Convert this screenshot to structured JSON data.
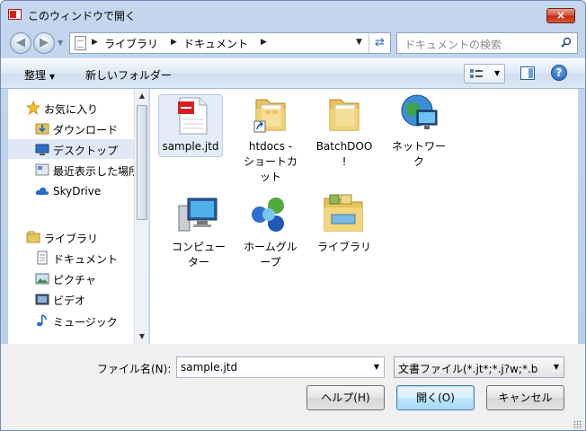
{
  "window": {
    "title": "このウィンドウで開く",
    "close_label": "×"
  },
  "address": {
    "crumbs": [
      "ライブラリ",
      "ドキュメント"
    ]
  },
  "search": {
    "placeholder": "ドキュメントの検索"
  },
  "toolbar": {
    "organize_label": "整理",
    "new_folder_label": "新しいフォルダー",
    "help_label": "?"
  },
  "nav": {
    "favorites_header": "お気に入り",
    "favorites": [
      "ダウンロード",
      "デスクトップ",
      "最近表示した場所",
      "SkyDrive"
    ],
    "libraries_header": "ライブラリ",
    "libraries": [
      "ドキュメント",
      "ピクチャ",
      "ビデオ",
      "ミュージック"
    ],
    "selected": "デスクトップ"
  },
  "files": [
    {
      "line1": "sample.jtd",
      "line2": "",
      "line3": ""
    },
    {
      "line1": "htdocs -",
      "line2": "ショートカ",
      "line3": "ット"
    },
    {
      "line1": "BatchDOO",
      "line2": "!",
      "line3": ""
    },
    {
      "line1": "ネットワー",
      "line2": "ク",
      "line3": ""
    },
    {
      "line1": "コンピュー",
      "line2": "ター",
      "line3": ""
    },
    {
      "line1": "ホームグル",
      "line2": "ープ",
      "line3": ""
    },
    {
      "line1": "ライブラリ",
      "line2": "",
      "line3": ""
    }
  ],
  "bottom": {
    "filename_label": "ファイル名(N):",
    "filename_value": "sample.jtd",
    "filetype_value": "文書ファイル(*.jt*;*.j?w;*.b",
    "help_button": "ヘルプ(H)",
    "open_button": "開く(O)",
    "cancel_button": "キャンセル"
  },
  "colors": {
    "title_bg": "#c5d7ee",
    "selection": "#dfe9f5",
    "close_red": "#c22e16"
  }
}
